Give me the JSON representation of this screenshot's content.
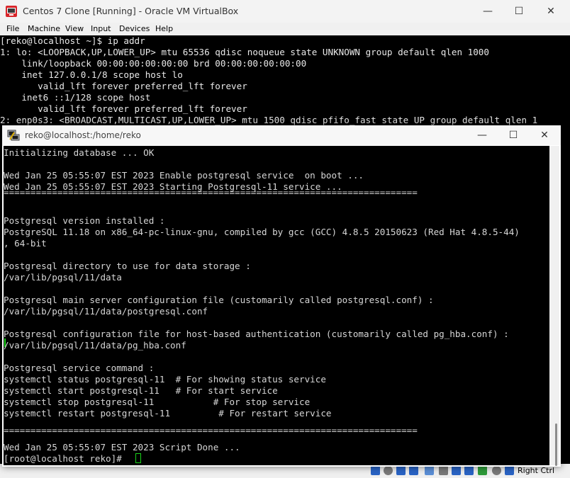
{
  "vbox": {
    "title": "Centos 7 Clone [Running] - Oracle VM VirtualBox",
    "controls": {
      "minimize": "—",
      "maximize": "☐",
      "close": "✕"
    },
    "menu": [
      "File",
      "Machine",
      "View",
      "Input",
      "Devices",
      "Help"
    ],
    "console_lines": [
      "[reko@localhost ~]$ ip addr",
      "1: lo: <LOOPBACK,UP,LOWER_UP> mtu 65536 qdisc noqueue state UNKNOWN group default qlen 1000",
      "    link/loopback 00:00:00:00:00:00 brd 00:00:00:00:00:00",
      "    inet 127.0.0.1/8 scope host lo",
      "       valid_lft forever preferred_lft forever",
      "    inet6 ::1/128 scope host",
      "       valid_lft forever preferred_lft forever",
      "2: enp0s3: <BROADCAST,MULTICAST,UP,LOWER_UP> mtu 1500 qdisc pfifo_fast state UP group default qlen 1"
    ],
    "host_key_label": "Right Ctrl",
    "status_icon_colors": [
      "#2a64c5",
      "#7a7a7a",
      "#2a64c5",
      "#2a64c5",
      "#5b8fd6",
      "#7a7a7a",
      "#2a64c5",
      "#2a64c5",
      "#2e9b3a",
      "#7a7a7a",
      "#2a64c5"
    ]
  },
  "putty": {
    "title": "reko@localhost:/home/reko",
    "controls": {
      "minimize": "—",
      "maximize": "☐",
      "close": "✕"
    },
    "lines": [
      "Initializing database ... OK",
      "",
      "Wed Jan 25 05:55:07 EST 2023 Enable postgresql service  on boot ...",
      "Wed Jan 25 05:55:07 EST 2023 Starting Postgresql-11 service ...",
      "=============================================================================",
      "",
      "Postgresql version installed :",
      "PostgreSQL 11.18 on x86_64-pc-linux-gnu, compiled by gcc (GCC) 4.8.5 20150623 (Red Hat 4.8.5-44)",
      ", 64-bit",
      "",
      "Postgresql directory to use for data storage :",
      "/var/lib/pgsql/11/data",
      "",
      "Postgresql main server configuration file (customarily called postgresql.conf) :",
      "/var/lib/pgsql/11/data/postgresql.conf",
      "",
      "Postgresql configuration file for host-based authentication (customarily called pg_hba.conf) :",
      "/var/lib/pgsql/11/data/pg_hba.conf",
      "",
      "Postgresql service command :",
      "systemctl status postgresql-11  # For showing status service",
      "systemctl start postgresql-11   # For start service",
      "systemctl stop postgresql-11           # For stop service",
      "systemctl restart postgresql-11         # For restart service",
      "",
      "=============================================================================",
      "Wed Jan 25 05:55:07 EST 2023 Script Done ...",
      "[root@localhost reko]# "
    ],
    "cursor_color": "#19d219"
  }
}
